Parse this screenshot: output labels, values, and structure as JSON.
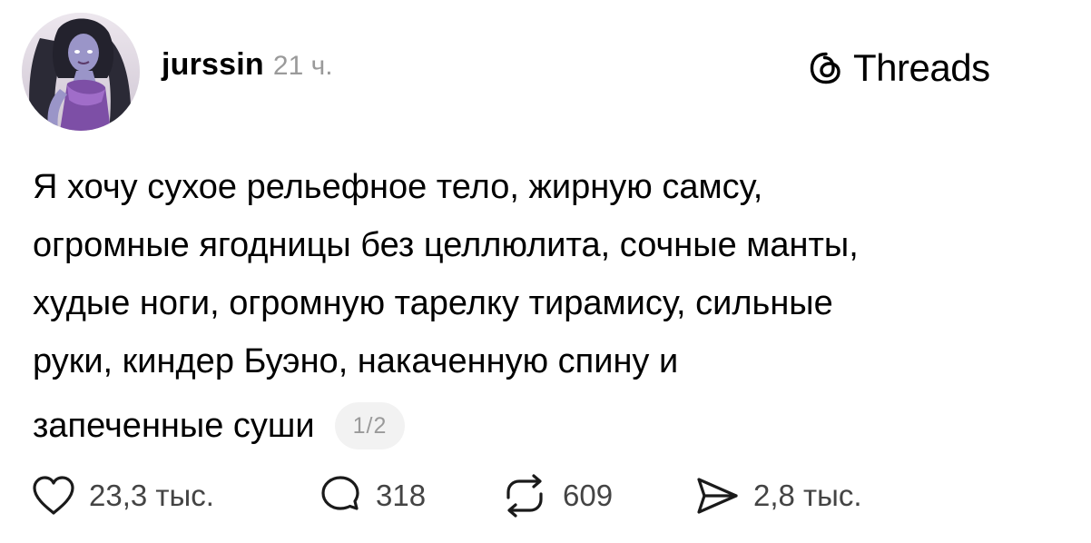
{
  "post": {
    "author": "jurssin",
    "time": "21 ч.",
    "brand": "Threads",
    "text_lines": [
      "Я хочу сухое рельефное тело, жирную самсу,",
      "огромные ягодницы без целлюлита, сочные манты,",
      "худые ноги, огромную тарелку тирамису, сильные",
      "руки, киндер Буэно, накаченную спину и",
      "запеченные суши"
    ],
    "page_indicator": "1/2",
    "icons": {
      "brand": "threads-logo-icon",
      "like": "heart-icon",
      "reply": "comment-bubble-icon",
      "repost": "repost-icon",
      "share": "send-icon"
    },
    "stats": {
      "likes": "23,3 тыс.",
      "replies": "318",
      "reposts": "609",
      "shares": "2,8 тыс."
    }
  }
}
